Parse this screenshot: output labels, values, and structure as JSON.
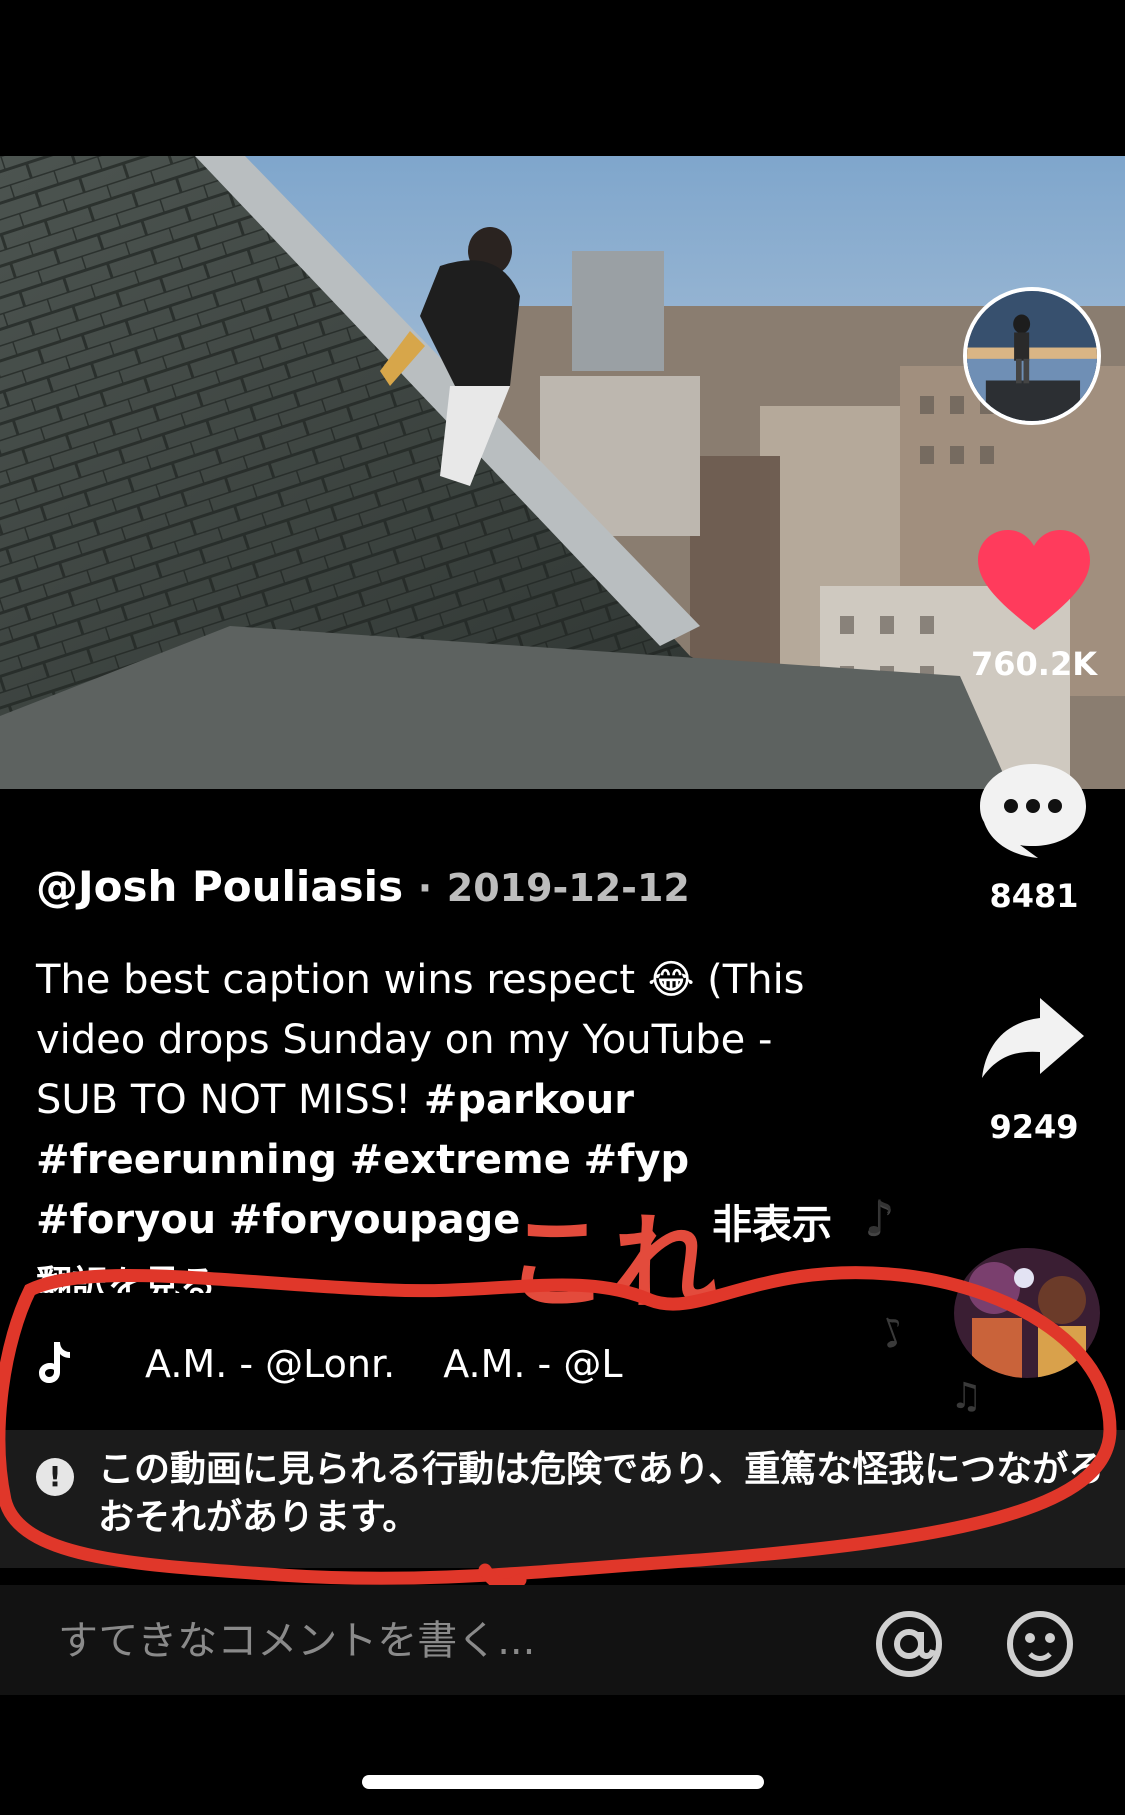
{
  "post": {
    "author": "@Josh Pouliasis",
    "separator": "·",
    "date": "2019-12-12",
    "caption_text": "The best caption wins respect 😂 (This video drops Sunday on my YouTube - SUB TO NOT MISS!",
    "hashtags": [
      "#parkour",
      "#freerunning",
      "#extreme",
      "#fyp",
      "#foryou",
      "#foryoupage"
    ],
    "translate_label": "翻訳を見る"
  },
  "actions": {
    "likes": "760.2K",
    "comments": "8481",
    "shares": "9249",
    "avatar_icon": "creator-avatar",
    "like_icon": "heart-icon",
    "comment_icon": "chat-bubble-icon",
    "share_icon": "share-arrow-icon"
  },
  "music": {
    "icon": "tiktok-note-icon",
    "track_1": "A.M. - @Lonr.",
    "track_2": "A.M. - @L"
  },
  "annotation": {
    "kore": "これ",
    "hide_label": "非表示",
    "color": "#e34b3c"
  },
  "warning": {
    "icon": "exclamation-icon",
    "text": "この動画に見られる行動は危険であり、重篤な怪我につながるおそれがあります。"
  },
  "comment_bar": {
    "placeholder": "すてきなコメントを書く...",
    "mention_icon": "at-sign-icon",
    "emoji_icon": "emoji-icon"
  },
  "colors": {
    "like": "#ff3b5c",
    "background": "#000000",
    "warning_bg": "#1b1b1b"
  }
}
